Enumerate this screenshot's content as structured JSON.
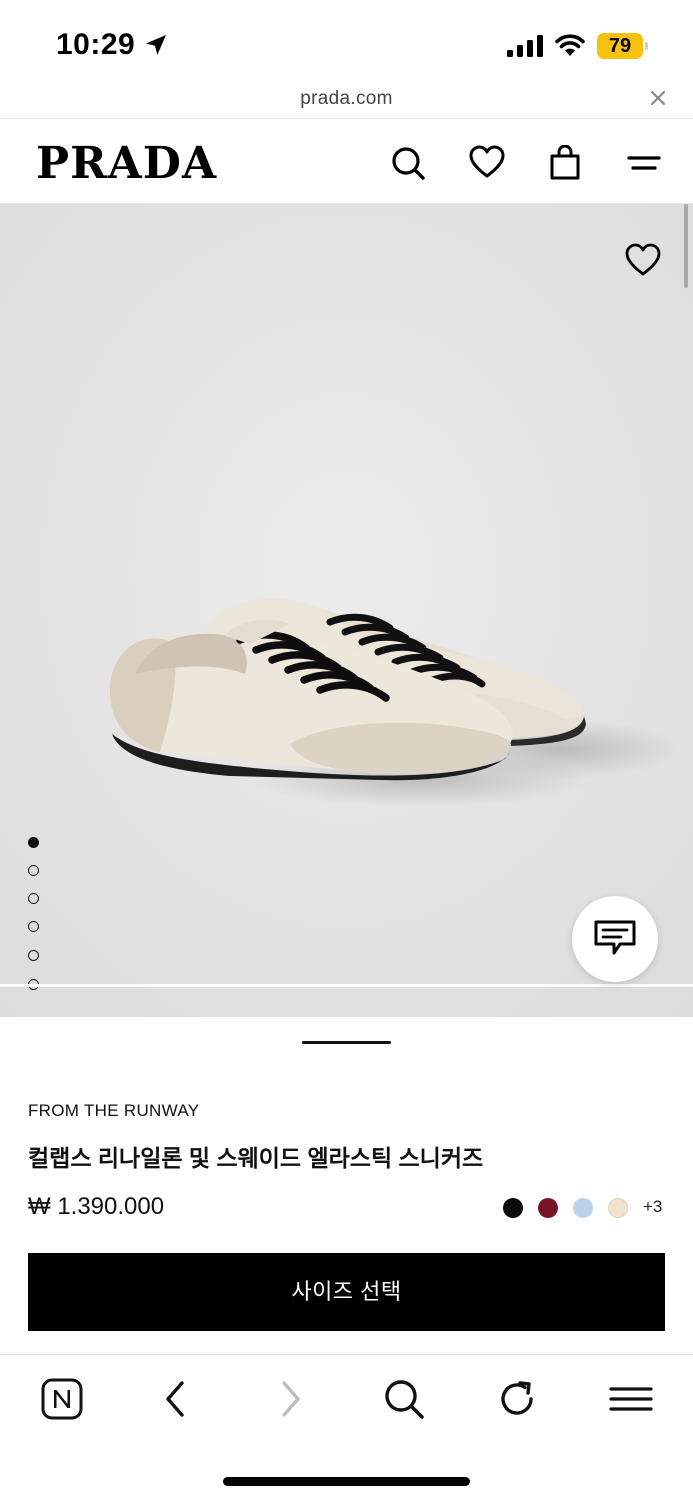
{
  "status_bar": {
    "time": "10:29",
    "battery": "79",
    "battery_color": "#f7c20e"
  },
  "browser": {
    "url": "prada.com",
    "close_icon": "close-icon"
  },
  "header": {
    "logo": "PRADA",
    "icons": [
      "search-icon",
      "heart-icon",
      "bag-icon",
      "menu-icon"
    ]
  },
  "gallery": {
    "image_description": "sneakers-image",
    "dots_total": 6,
    "active_index": 0,
    "favorite_icon": "heart-icon",
    "chat_icon": "chat-icon"
  },
  "product": {
    "collection": "FROM THE RUNWAY",
    "name": "컬랩스 리나일론 및 스웨이드 엘라스틱 스니커즈",
    "price": "₩ 1.390.000",
    "colors": [
      "#0a0a0a",
      "#7a1428",
      "#bcd3ea",
      "#f0e2cd"
    ],
    "more_colors": "+3",
    "size_button": "사이즈 선택"
  },
  "toolbar": {
    "icons": [
      "naver-icon",
      "back-icon",
      "forward-icon",
      "search-icon",
      "reload-icon",
      "menu-icon"
    ]
  }
}
